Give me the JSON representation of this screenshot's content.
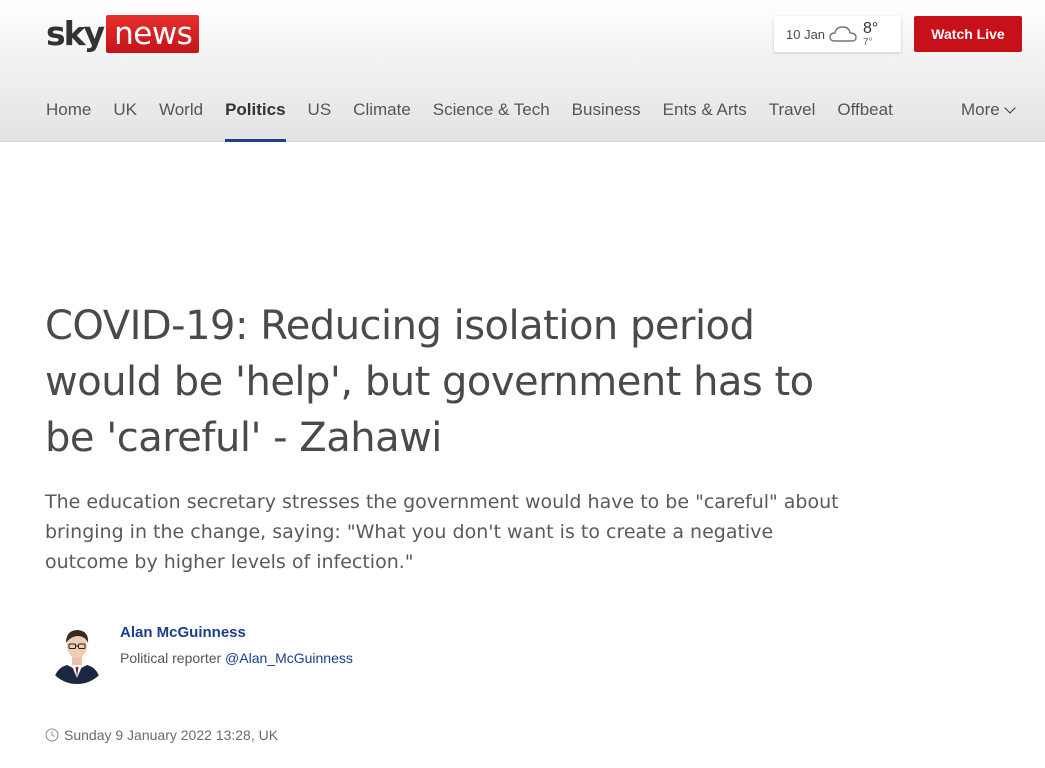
{
  "header": {
    "logo": {
      "sky": "sky",
      "news": "news"
    },
    "weather": {
      "date": "10 Jan",
      "icon": "cloud-icon",
      "high": "8°",
      "low": "7°"
    },
    "watch_live_label": "Watch Live"
  },
  "nav": {
    "items": [
      {
        "label": "Home"
      },
      {
        "label": "UK"
      },
      {
        "label": "World"
      },
      {
        "label": "Politics",
        "active": true
      },
      {
        "label": "US"
      },
      {
        "label": "Climate"
      },
      {
        "label": "Science & Tech"
      },
      {
        "label": "Business"
      },
      {
        "label": "Ents & Arts"
      },
      {
        "label": "Travel"
      },
      {
        "label": "Offbeat"
      }
    ],
    "more_label": "More"
  },
  "article": {
    "headline": "COVID-19: Reducing isolation period would be 'help', but government has to be 'careful' - Zahawi",
    "standfirst": "The education secretary stresses the government would have to be \"careful\" about bringing in the change, saying: \"What you don't want is to create a negative outcome by higher levels of infection.\"",
    "author": {
      "name": "Alan McGuinness",
      "role": "Political reporter",
      "handle": "@Alan_McGuinness"
    },
    "timestamp": "Sunday 9 January 2022 13:28, UK"
  },
  "colors": {
    "brand_red": "#c8101a",
    "link_blue": "#1b3f8b",
    "active_underline": "#1b3f8b"
  }
}
